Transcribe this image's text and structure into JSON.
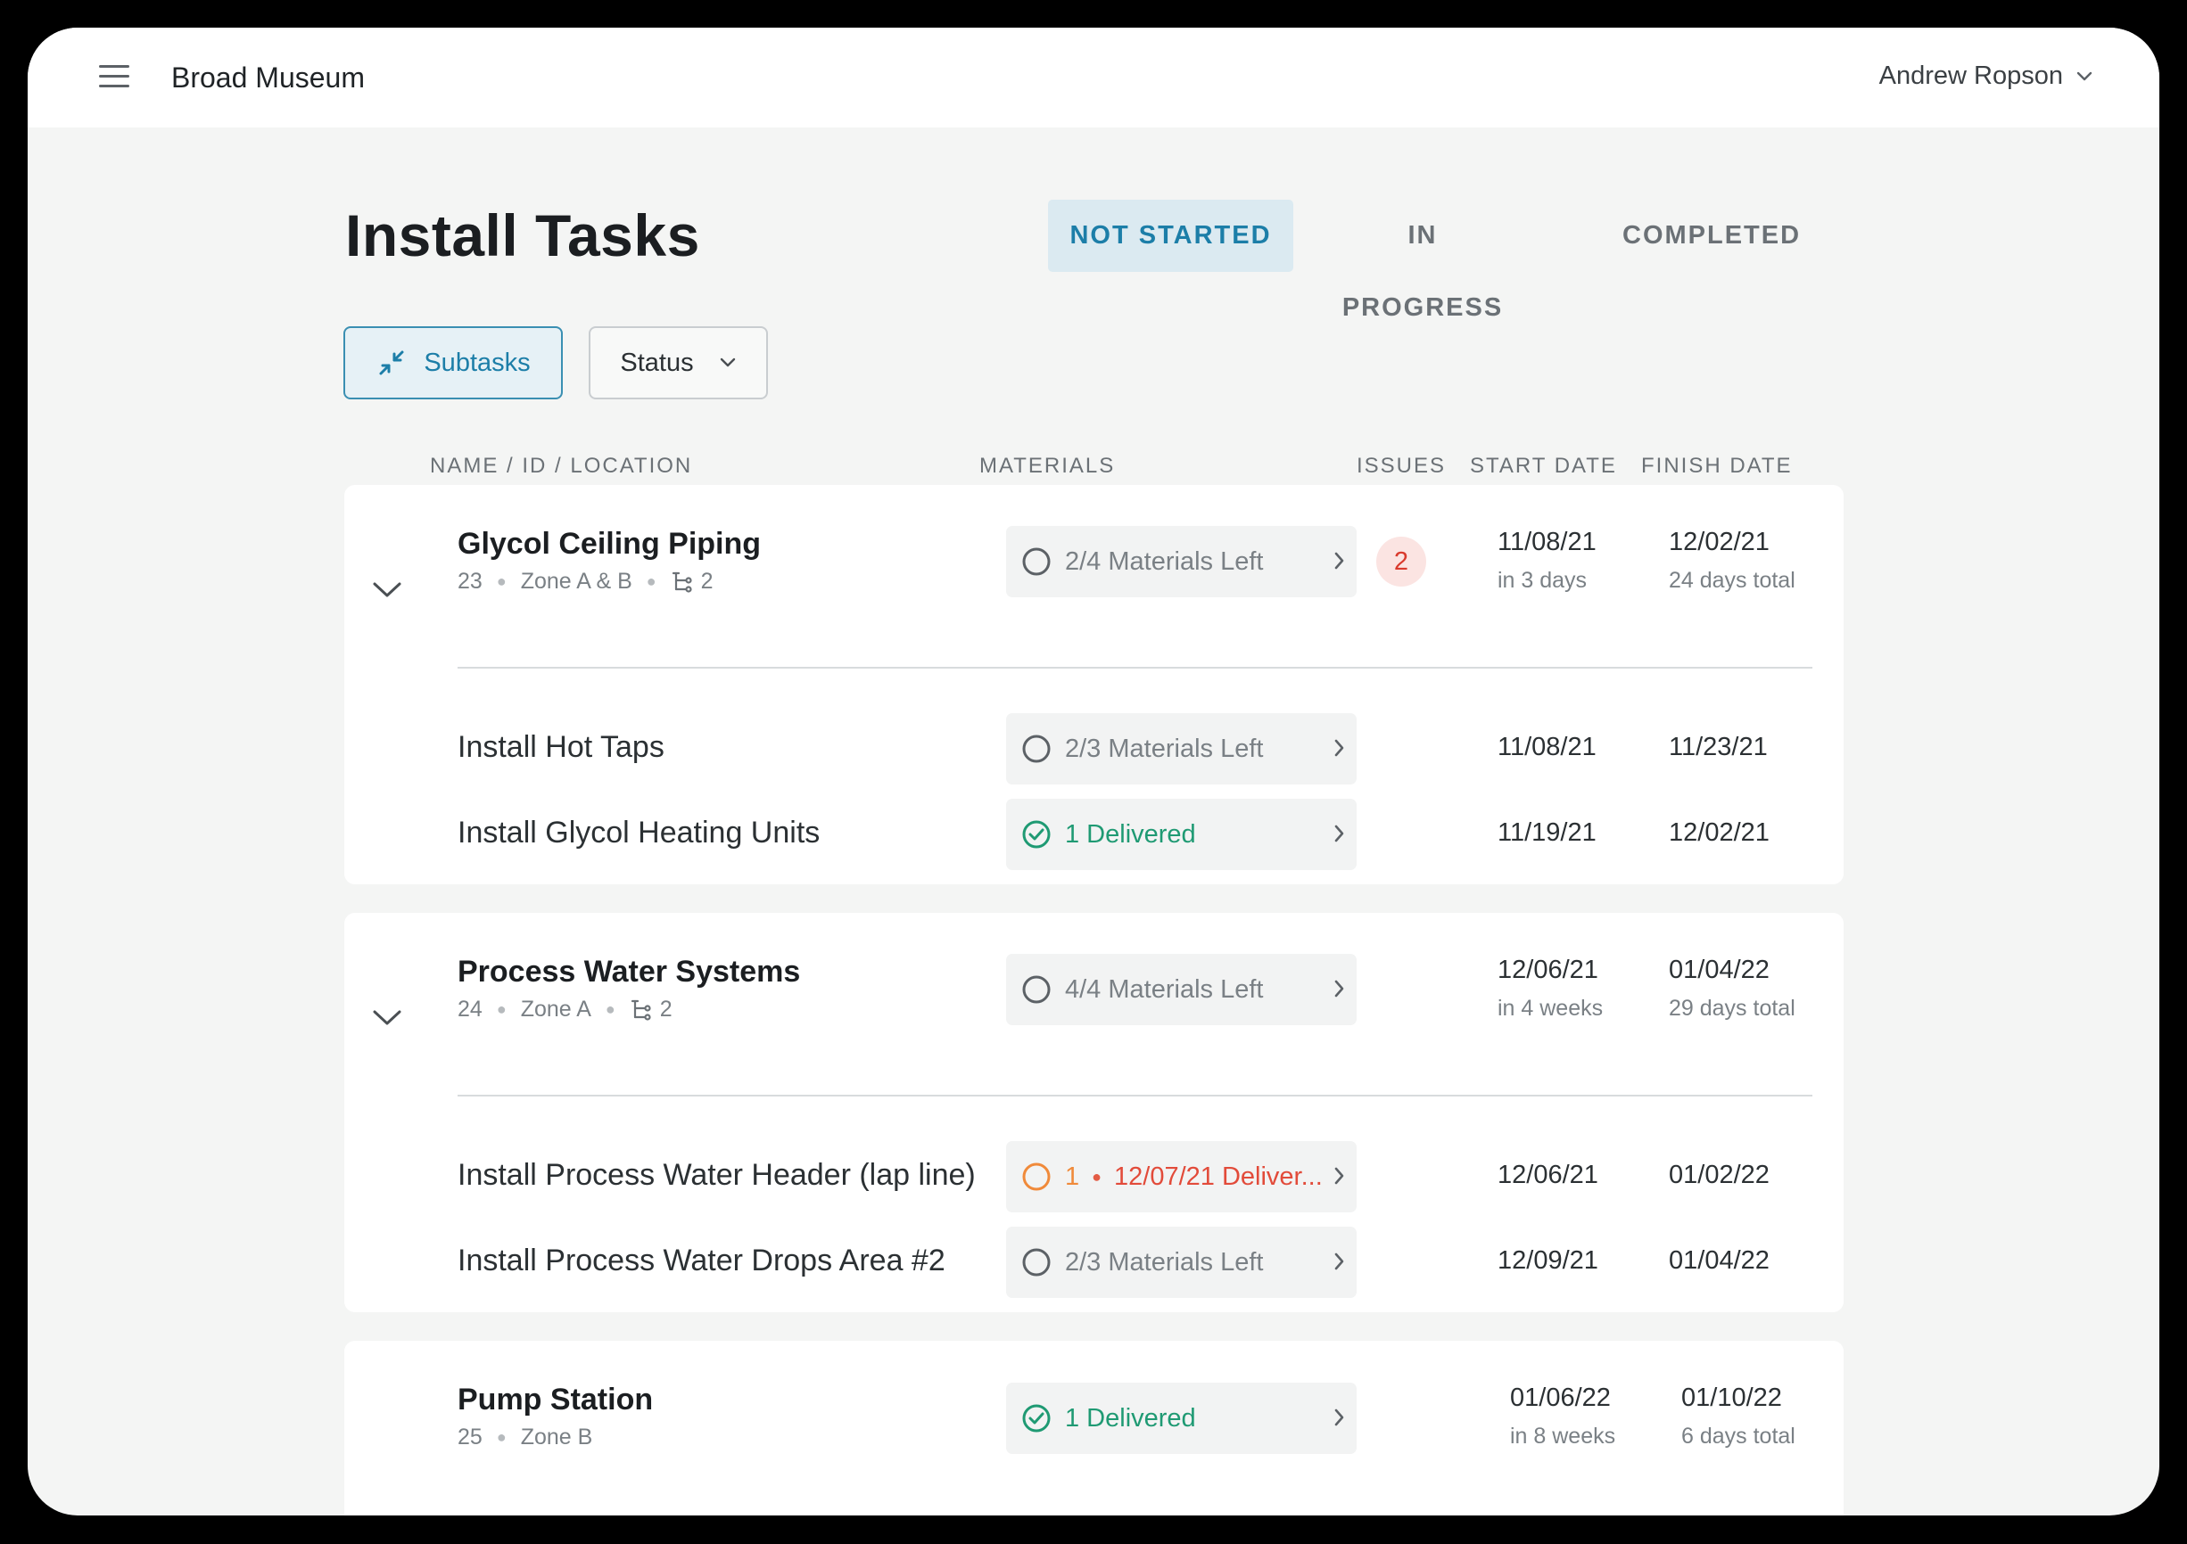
{
  "app": {
    "title": "Broad Museum",
    "user": "Andrew Ropson"
  },
  "page": {
    "title": "Install Tasks"
  },
  "tabs": [
    {
      "label": "NOT STARTED",
      "active": true
    },
    {
      "label": "IN PROGRESS",
      "active": false
    },
    {
      "label": "COMPLETED",
      "active": false
    }
  ],
  "filters": {
    "subtasks_label": "Subtasks",
    "status_label": "Status"
  },
  "columns": {
    "name": "NAME / ID / LOCATION",
    "materials": "MATERIALS",
    "issues": "ISSUES",
    "start": "START DATE",
    "finish": "FINISH DATE"
  },
  "tasks": [
    {
      "name": "Glycol Ceiling Piping",
      "id": "23",
      "location": "Zone A & B",
      "subtask_count": "2",
      "materials": "2/4 Materials Left",
      "issues": "2",
      "start": "11/08/21",
      "start_note": "in 3 days",
      "finish": "12/02/21",
      "finish_note": "24 days total",
      "subtasks": [
        {
          "name": "Install Hot Taps",
          "materials": "2/3 Materials Left",
          "start": "11/08/21",
          "finish": "11/23/21"
        },
        {
          "name": "Install Glycol Heating Units",
          "materials": "1 Delivered",
          "start": "11/19/21",
          "finish": "12/02/21"
        }
      ]
    },
    {
      "name": "Process Water Systems",
      "id": "24",
      "location": "Zone A",
      "subtask_count": "2",
      "materials": "4/4 Materials Left",
      "start": "12/06/21",
      "start_note": "in 4 weeks",
      "finish": "01/04/22",
      "finish_note": "29 days total",
      "subtasks": [
        {
          "name": "Install Process Water Header (lap line)",
          "materials_qty": "1",
          "materials_msg": "12/07/21 Deliver...",
          "start": "12/06/21",
          "finish": "01/02/22"
        },
        {
          "name": "Install Process Water Drops Area #2",
          "materials": "2/3 Materials Left",
          "start": "12/09/21",
          "finish": "01/04/22"
        }
      ]
    },
    {
      "name": "Pump Station",
      "id": "25",
      "location": "Zone B",
      "materials": "1 Delivered",
      "start": "01/06/22",
      "start_note": "in 8 weeks",
      "finish": "01/10/22",
      "finish_note": "6 days total"
    }
  ],
  "colors": {
    "accent": "#1c7ea8",
    "delivered": "#1f9a73",
    "warning": "#f08a3a",
    "danger": "#e24b3a",
    "background": "#f4f5f4",
    "card": "#ffffff"
  },
  "icons": {
    "menu": "hamburger-icon",
    "user_dropdown": "chevron-down-icon",
    "subtasks": "collapse-arrows-icon",
    "status_dropdown": "chevron-down-icon",
    "expand": "chevron-down-icon",
    "subtask_tree": "subtask-tree-icon",
    "pending": "empty-circle-icon",
    "delivered": "check-circle-icon",
    "warning": "orange-circle-icon",
    "arrow": "chevron-right-icon"
  }
}
